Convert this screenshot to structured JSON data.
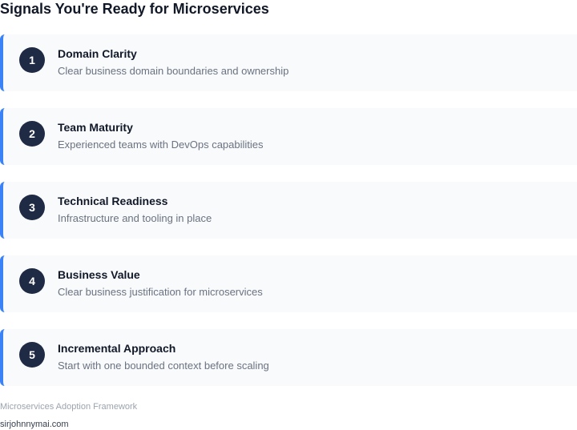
{
  "page": {
    "title": "Signals You're Ready for Microservices"
  },
  "signals": [
    {
      "number": "1",
      "title": "Domain Clarity",
      "description": "Clear business domain boundaries and ownership"
    },
    {
      "number": "2",
      "title": "Team Maturity",
      "description": "Experienced teams with DevOps capabilities"
    },
    {
      "number": "3",
      "title": "Technical Readiness",
      "description": "Infrastructure and tooling in place"
    },
    {
      "number": "4",
      "title": "Business Value",
      "description": "Clear business justification for microservices"
    },
    {
      "number": "5",
      "title": "Incremental Approach",
      "description": "Start with one bounded context before scaling"
    }
  ],
  "footer": {
    "caption": "Microservices Adoption Framework",
    "url": "sirjohnnymai.com"
  },
  "colors": {
    "accent": "#3b82f6",
    "badge": "#1f2a44",
    "card_background": "#f8fafc"
  }
}
